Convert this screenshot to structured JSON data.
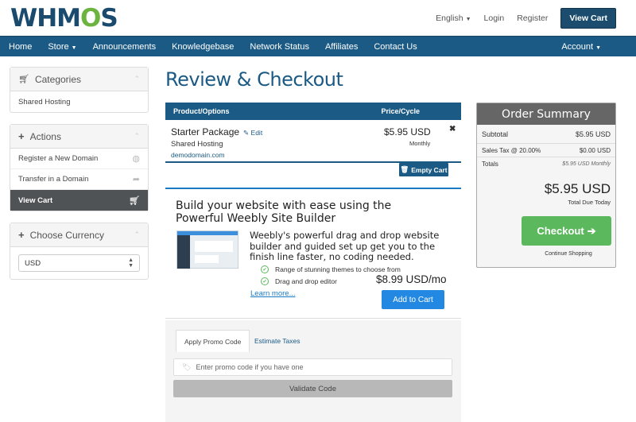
{
  "brand": {
    "logo_text_1": "WHM",
    "logo_text_2": "O",
    "logo_text_3": "S"
  },
  "top_links": {
    "language": "English",
    "login": "Login",
    "register": "Register",
    "view_cart": "View Cart"
  },
  "nav": {
    "items": [
      "Home",
      "Store",
      "Announcements",
      "Knowledgebase",
      "Network Status",
      "Affiliates",
      "Contact Us"
    ],
    "account": "Account"
  },
  "sidebar": {
    "categories": {
      "title": "Categories",
      "items": [
        "Shared Hosting"
      ]
    },
    "actions": {
      "title": "Actions",
      "items": [
        "Register a New Domain",
        "Transfer in a Domain",
        "View Cart"
      ]
    },
    "currency": {
      "title": "Choose Currency",
      "selected": "USD"
    }
  },
  "page_title": "Review & Checkout",
  "cart": {
    "col_product": "Product/Options",
    "col_price": "Price/Cycle",
    "item": {
      "name": "Starter Package",
      "edit": "Edit",
      "group": "Shared Hosting",
      "domain": "demodomain.com",
      "price": "$5.95 USD",
      "cycle": "Monthly"
    },
    "empty_button": "Empty Cart"
  },
  "promo": {
    "title": "Build your website with ease using the Powerful Weebly Site Builder",
    "description": "Weebly's powerful drag and drop website builder and guided set up get you to the finish line faster, no coding needed.",
    "features": [
      "Range of stunning themes to choose from",
      "Drag and drop editor"
    ],
    "price": "$8.99 USD/mo",
    "learn_more": "Learn more...",
    "add_to_cart": "Add to Cart"
  },
  "tabs": {
    "active": "Apply Promo Code",
    "other": "Estimate Taxes",
    "promo_placeholder": "Enter promo code if you have one",
    "validate": "Validate Code"
  },
  "summary": {
    "title": "Order Summary",
    "subtotal_label": "Subtotal",
    "subtotal_value": "$5.95 USD",
    "tax_label": "Sales Tax @ 20.00%",
    "tax_value": "$0.00 USD",
    "totals_label": "Totals",
    "totals_value": "$5.95 USD Monthly",
    "total_due": "$5.95 USD",
    "due_today": "Total Due Today",
    "checkout": "Checkout",
    "continue": "Continue Shopping"
  },
  "colors": {
    "primary": "#1a5a85",
    "accent_blue": "#2388e2",
    "checkout_green": "#5cb85c",
    "logo_green": "#6cb33f"
  }
}
